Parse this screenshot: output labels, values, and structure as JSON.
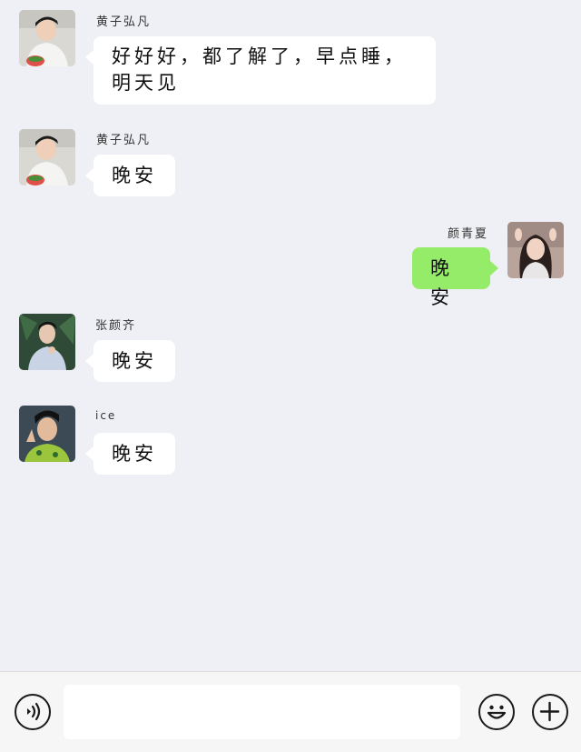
{
  "messages": [
    {
      "sender": "黄子弘凡",
      "text": "好好好，都了解了，早点睡，明天见",
      "side": "left",
      "avatar": "avatar-huang"
    },
    {
      "sender": "黄子弘凡",
      "text": "晚安",
      "side": "left",
      "avatar": "avatar-huang"
    },
    {
      "sender": "颜青夏",
      "text": "晚安",
      "side": "right",
      "avatar": "avatar-yan"
    },
    {
      "sender": "张颜齐",
      "text": "晚安",
      "side": "left",
      "avatar": "avatar-zhang"
    },
    {
      "sender": "ice",
      "text": "晚安",
      "side": "left",
      "avatar": "avatar-ice"
    }
  ],
  "input_bar": {
    "voice_icon": "voice-icon",
    "emoji_icon": "emoji-icon",
    "plus_icon": "plus-icon",
    "input_value": ""
  },
  "colors": {
    "background": "#eff0f5",
    "bubble_incoming": "#ffffff",
    "bubble_outgoing": "#95ec69"
  }
}
